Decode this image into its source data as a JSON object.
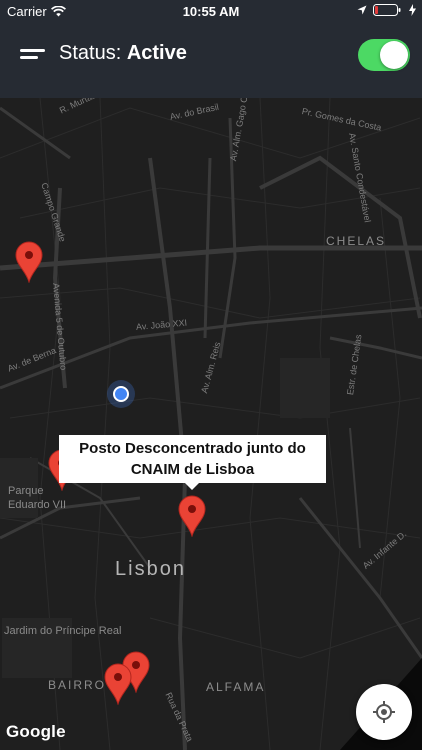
{
  "status_bar": {
    "carrier": "Carrier",
    "time": "10:55 AM"
  },
  "header": {
    "title_prefix": "Status:",
    "status_value": "Active",
    "toggle_on": true
  },
  "map": {
    "city": "Lisbon",
    "districts": [
      "CHELAS",
      "ALFAMA",
      "BAIRRO"
    ],
    "parks": [
      "Parque",
      "Eduardo VII",
      "Jardim do Príncipe Real"
    ],
    "streets": [
      "R. Murtas",
      "Av. do Brasil",
      "Pr. Gomes da Costa",
      "Av. Santo Condestável",
      "Campo Grande",
      "Av. Alm. Gago Coutinho",
      "Av. João XXI",
      "Avenida 5 de Outubro",
      "Av. de Berna",
      "Av. Alm. Reis",
      "Estr. de Chelas",
      "Av. Infante D.",
      "Rua da Prata"
    ],
    "callout_text": "Posto Desconcentrado junto do CNAIM de Lisboa",
    "attribution": "Google"
  },
  "colors": {
    "header_bg": "#262b33",
    "toggle_on": "#4cd964",
    "pin": "#ea4335",
    "user_location": "#4285f4",
    "map_bg": "#1f1f1f"
  }
}
